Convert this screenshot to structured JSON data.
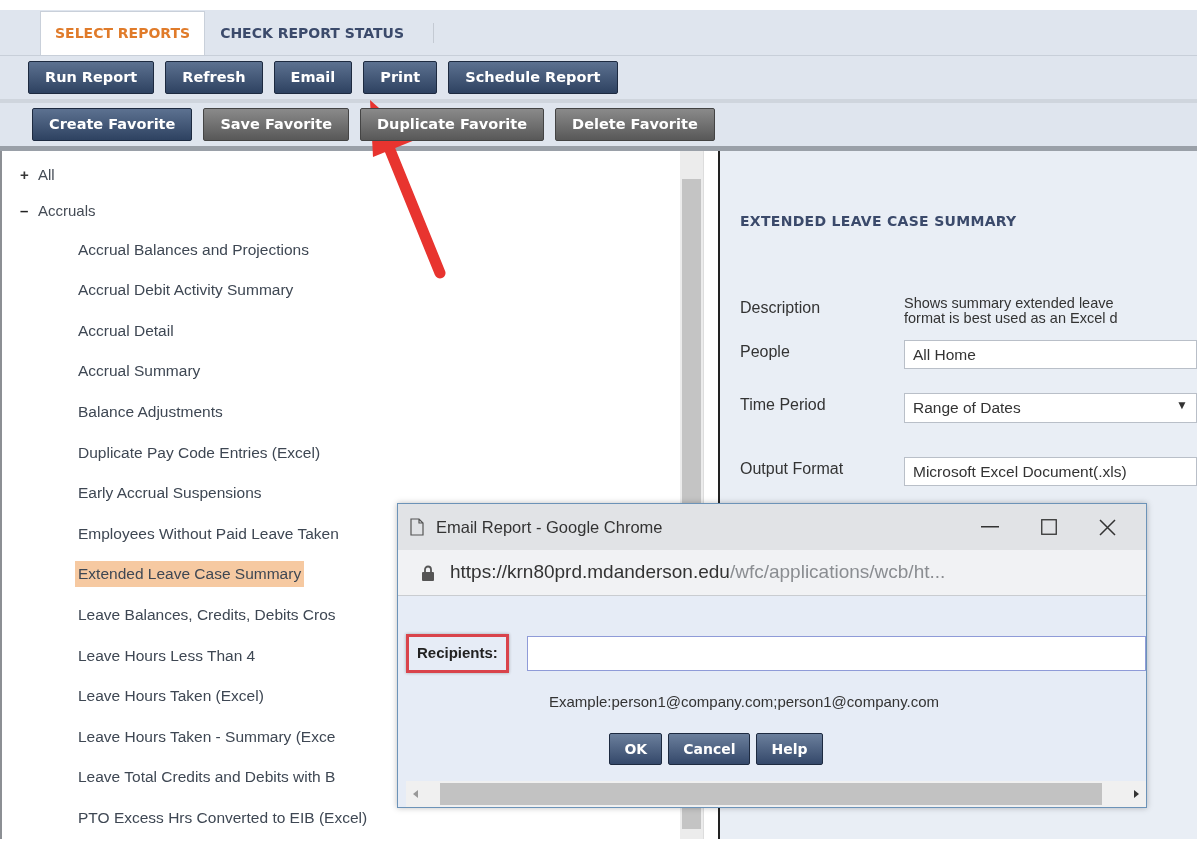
{
  "tabs": [
    {
      "label": "SELECT REPORTS",
      "selected": true
    },
    {
      "label": "CHECK REPORT STATUS",
      "selected": false
    }
  ],
  "toolbar": [
    {
      "label": "Run Report",
      "disabled": false
    },
    {
      "label": "Refresh",
      "disabled": false
    },
    {
      "label": "Email",
      "disabled": false
    },
    {
      "label": "Print",
      "disabled": false
    },
    {
      "label": "Schedule Report",
      "disabled": false
    }
  ],
  "favorites_toolbar": [
    {
      "label": "Create Favorite",
      "disabled": false
    },
    {
      "label": "Save Favorite",
      "disabled": true
    },
    {
      "label": "Duplicate Favorite",
      "disabled": true
    },
    {
      "label": "Delete Favorite",
      "disabled": true
    }
  ],
  "tree": [
    {
      "label": "All",
      "toggle": "+",
      "expanded": false
    },
    {
      "label": "Accruals",
      "toggle": "–",
      "expanded": true,
      "children": [
        {
          "label": "Accrual Balances and Projections",
          "selected": false
        },
        {
          "label": "Accrual Debit Activity Summary",
          "selected": false
        },
        {
          "label": "Accrual Detail",
          "selected": false
        },
        {
          "label": "Accrual Summary",
          "selected": false
        },
        {
          "label": "Balance Adjustments",
          "selected": false
        },
        {
          "label": "Duplicate Pay Code Entries (Excel)",
          "selected": false
        },
        {
          "label": "Early Accrual Suspensions",
          "selected": false
        },
        {
          "label": "Employees Without Paid Leave Taken",
          "selected": false
        },
        {
          "label": "Extended Leave Case Summary",
          "selected": true
        },
        {
          "label": "Leave Balances, Credits, Debits Cros",
          "selected": false
        },
        {
          "label": "Leave Hours Less Than 4",
          "selected": false
        },
        {
          "label": "Leave Hours Taken (Excel)",
          "selected": false
        },
        {
          "label": "Leave Hours Taken - Summary (Exce",
          "selected": false
        },
        {
          "label": "Leave Total Credits and Debits with B",
          "selected": false
        },
        {
          "label": "PTO Excess Hrs Converted to EIB (Excel)",
          "selected": false
        }
      ]
    }
  ],
  "report": {
    "title": "EXTENDED LEAVE CASE SUMMARY",
    "fields": [
      {
        "kind": "text",
        "label": "Description",
        "lines": [
          "Shows summary extended leave",
          "format is best used as an Excel d"
        ]
      },
      {
        "kind": "input",
        "label": "People",
        "value": "All Home"
      },
      {
        "kind": "select",
        "label": "Time Period",
        "value": "Range of Dates",
        "caret": "▼"
      },
      {
        "kind": "select",
        "label": "Output Format",
        "value": "Microsoft Excel Document(.xls)"
      }
    ]
  },
  "dialog": {
    "title": "Email Report - Google Chrome",
    "url_host": "https://krn80prd.mdanderson.edu",
    "url_path": "/wfc/applications/wcb/ht...",
    "recipients_label": "Recipients:",
    "example": "Example:person1@company.com;person1@company.com",
    "buttons": [
      "OK",
      "Cancel",
      "Help"
    ]
  }
}
